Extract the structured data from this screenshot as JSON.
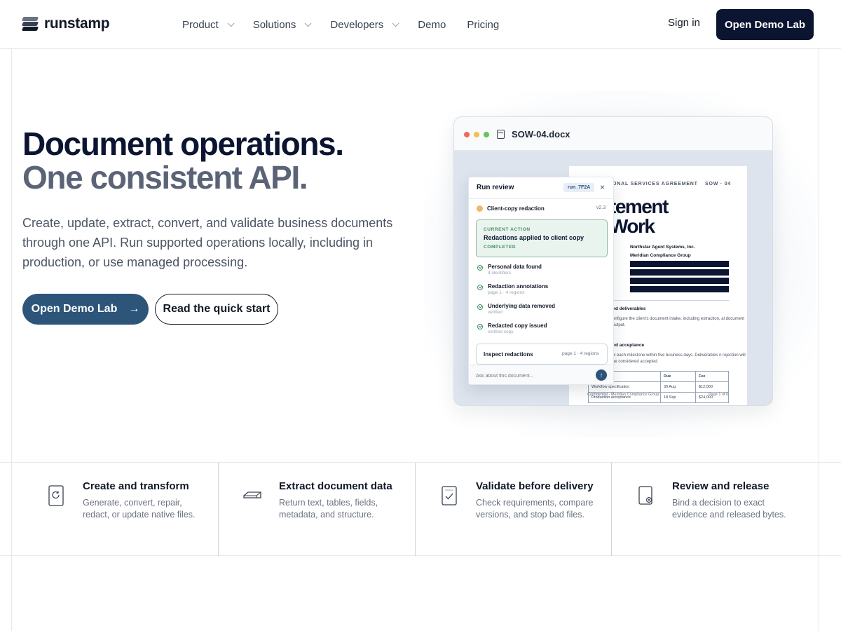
{
  "brand": {
    "name": "runstamp"
  },
  "nav": {
    "items": [
      {
        "label": "Product",
        "has_dropdown": true
      },
      {
        "label": "Solutions",
        "has_dropdown": true
      },
      {
        "label": "Developers",
        "has_dropdown": true
      },
      {
        "label": "Demo",
        "has_dropdown": false
      },
      {
        "label": "Pricing",
        "has_dropdown": false
      }
    ],
    "sign_in": "Sign in",
    "cta": "Open Demo Lab"
  },
  "hero": {
    "title_line1": "Document operations.",
    "title_line2": "One consistent API.",
    "lead": "Create, update, extract, convert, and validate business documents through one API. Run supported operations locally, including in production, or use managed processing.",
    "primary_button": "Open Demo Lab",
    "primary_arrow": "→",
    "secondary_button": "Read the quick start"
  },
  "mock": {
    "window_title": "SOW-04.docx",
    "document": {
      "kicker": "ONAL SERVICES AGREEMENT",
      "code": "SOW · 04",
      "title_line1": "tement",
      "title_line2": "Work",
      "party1": "Northstar Agent Systems, Inc.",
      "party2": "Meridian Compliance Group",
      "section1_heading": "nd deliverables",
      "section1_text": "onfigure the client's document intake, including extraction, al document output.",
      "section2_heading": "nd acceptance",
      "section2_text": "w each milestone within five business days. Deliverables n rejection will be considered accepted.",
      "table": {
        "headers": [
          "",
          "Due",
          "Fee"
        ],
        "rows": [
          [
            "Workflow specification",
            "30 Aug",
            "$12,000"
          ],
          [
            "Production acceptance",
            "18 Sep",
            "$24,000"
          ]
        ]
      },
      "footer_left": "Confidential · Meridian Compliance Group",
      "footer_right": "Page 1 of 6"
    },
    "panel": {
      "title": "Run review",
      "run_id": "run_7F2A",
      "close": "×",
      "task": "Client-copy redaction",
      "version": "v2.3",
      "current_action": {
        "label": "CURRENT ACTION",
        "text": "Redactions applied to client copy",
        "status": "COMPLETED"
      },
      "steps": [
        {
          "title": "Personal data found",
          "sub": "4 identifiers"
        },
        {
          "title": "Redaction annotations",
          "sub": "page 1 · 4 regions"
        },
        {
          "title": "Underlying data removed",
          "sub": "verified"
        },
        {
          "title": "Redacted copy issued",
          "sub": "verified copy"
        }
      ],
      "inspect_label": "Inspect redactions",
      "inspect_meta": "page 1 · 4 regions",
      "ask_placeholder": "Ask about this document...",
      "send": "↑"
    }
  },
  "features": [
    {
      "icon": "refresh-file-icon",
      "title": "Create and transform",
      "desc": "Generate, convert, repair, redact, or update native files."
    },
    {
      "icon": "tray-icon",
      "title": "Extract document data",
      "desc": "Return text, tables, fields, metadata, and structure."
    },
    {
      "icon": "checked-file-icon",
      "title": "Validate before delivery",
      "desc": "Check requirements, compare versions, and stop bad files."
    },
    {
      "icon": "stamped-file-icon",
      "title": "Review and release",
      "desc": "Bind a decision to exact evidence and released bytes."
    }
  ],
  "colors": {
    "navy": "#0b1430",
    "primary": "#2d5479",
    "success": "#3f8f63",
    "redaction": "#0b1430"
  }
}
